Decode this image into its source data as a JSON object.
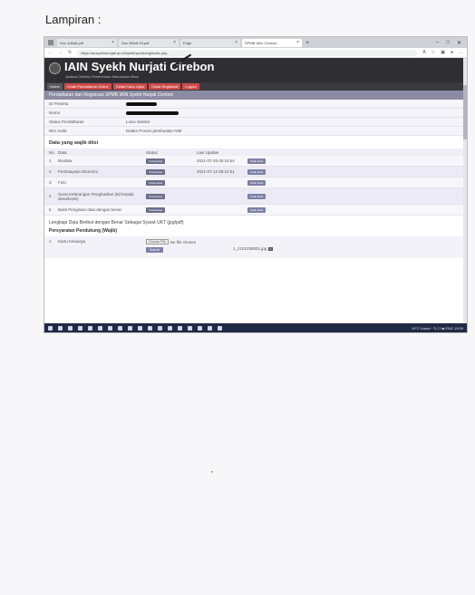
{
  "page": {
    "heading": "Lampiran :"
  },
  "browser": {
    "tabs": [
      {
        "label": "Doc 4d5a8.pdf",
        "active": false
      },
      {
        "label": "Doc 9f0e8 53.pdf",
        "active": false
      },
      {
        "label": "Edge",
        "active": false
      },
      {
        "label": "SPMB IAIN Cirebon",
        "active": true
      }
    ],
    "url": "https://iaucyekhnurjati.ac.id/spmb/spmb/reg/index.php"
  },
  "site": {
    "title": "IAIN Syekh Nurjati Cirebon",
    "subtitle": "Aplikasi Seleksi Penerimaan Mahasiswa Baru",
    "nav": [
      "Home",
      "Cetak Pendaftaran Online",
      "Cetak Kartu Ujian",
      "Cetak Registrasi",
      "Logout"
    ],
    "banner": "Pendaftaran dan Registrasi SPMB IAIN Syekh Nurjati Cirebon"
  },
  "info": [
    {
      "key": "ID Peserta",
      "value": "",
      "redacted": true
    },
    {
      "key": "Nama",
      "value": "",
      "redacted": true
    },
    {
      "key": "Status Pendaftaran",
      "value": "Lulus Seleksi",
      "redacted": false
    },
    {
      "key": "Nim Anda",
      "value": "Dalam Proses pembuatan NIM",
      "redacted": false
    }
  ],
  "data_wajib": {
    "title": "Data yang wajib diisi",
    "headers": [
      "No",
      "Data",
      "Status",
      "Last Update",
      ""
    ],
    "rows": [
      {
        "no": "1",
        "data": "Biodata",
        "status": "Terlengkapi",
        "update": "2021-07-33 05:16:54",
        "action": "Ubah Data"
      },
      {
        "no": "2",
        "data": "Pembiayaan Ekonomi",
        "status": "Terlengkapi",
        "update": "2021-07-12 08:12:51",
        "action": "Ubah Data"
      },
      {
        "no": "3",
        "data": "Foto",
        "status": "Terlengkapi",
        "update": "",
        "action": "Ubah Data"
      },
      {
        "no": "4",
        "data": "Surat Keterangan Penghasilan (ttd kepala desa/lurah)",
        "status": "Terlengkapi",
        "update": "",
        "action": "Ubah Data"
      },
      {
        "no": "5",
        "data": "Bukti Pengisian data dengan benar",
        "status": "Terlengkapi",
        "update": "",
        "action": "Ubah Data"
      }
    ]
  },
  "lengkapi": "Lengkapi Data Berikut dengan Benar Sebagai Syarat UKT (jpg/pdf)",
  "persyaratan": {
    "title": "Persyaratan Pendukung (Wajib)",
    "rows": [
      {
        "no": "1",
        "label": "Kartu Keluarga",
        "choose": "Choose File",
        "nofile": "No file chosen",
        "submit": "Submit",
        "file": "1_2101338001.jpg"
      }
    ]
  },
  "taskbar": {
    "tray": "19°C Kabut ^ ↻ ☐ ■ ENG 19:09"
  }
}
